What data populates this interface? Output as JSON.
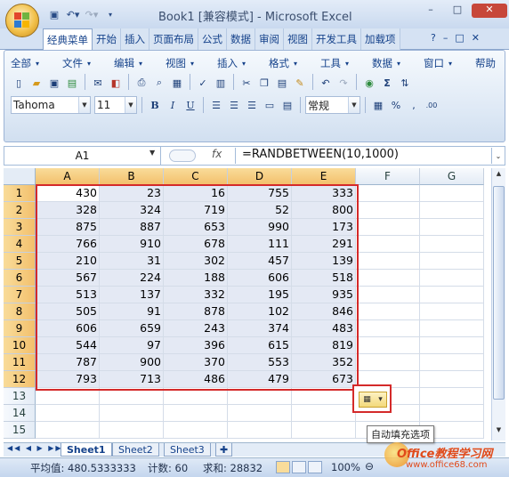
{
  "window": {
    "title": "Book1  [兼容模式] - Microsoft Excel"
  },
  "ribbon_tabs": [
    "经典菜单",
    "开始",
    "插入",
    "页面布局",
    "公式",
    "数据",
    "审阅",
    "视图",
    "开发工具",
    "加载项"
  ],
  "menus": [
    "全部",
    "文件",
    "编辑",
    "视图",
    "插入",
    "格式",
    "工具",
    "数据",
    "窗口",
    "帮助"
  ],
  "font": {
    "name": "Tahoma",
    "size": "11"
  },
  "number_format": "常规",
  "formula_bar": {
    "cell_ref": "A1",
    "fx": "fx",
    "formula": "=RANDBETWEEN(10,1000)"
  },
  "columns": [
    "A",
    "B",
    "C",
    "D",
    "E",
    "F",
    "G"
  ],
  "rows": [
    "1",
    "2",
    "3",
    "4",
    "5",
    "6",
    "7",
    "8",
    "9",
    "10",
    "11",
    "12",
    "13",
    "14",
    "15"
  ],
  "cells": [
    [
      430,
      23,
      16,
      755,
      333
    ],
    [
      328,
      324,
      719,
      52,
      800
    ],
    [
      875,
      887,
      653,
      990,
      173
    ],
    [
      766,
      910,
      678,
      111,
      291
    ],
    [
      210,
      31,
      302,
      457,
      139
    ],
    [
      567,
      224,
      188,
      606,
      518
    ],
    [
      513,
      137,
      332,
      195,
      935
    ],
    [
      505,
      91,
      878,
      102,
      846
    ],
    [
      606,
      659,
      243,
      374,
      483
    ],
    [
      544,
      97,
      396,
      615,
      819
    ],
    [
      787,
      900,
      370,
      553,
      352
    ],
    [
      793,
      713,
      486,
      479,
      673
    ]
  ],
  "sheets": [
    "Sheet1",
    "Sheet2",
    "Sheet3"
  ],
  "status": {
    "average": "平均值: 480.5333333",
    "count": "计数: 60",
    "sum": "求和: 28832",
    "zoom": "100%"
  },
  "autofill_tooltip": "自动填充选项",
  "watermark": {
    "line1": "Office教程学习网",
    "line2": "www.office68.com"
  },
  "colors": {
    "selection_border": "#d42a2a",
    "header_highlight": "#f3c06c",
    "selection_fill": "#e4e9f4"
  }
}
